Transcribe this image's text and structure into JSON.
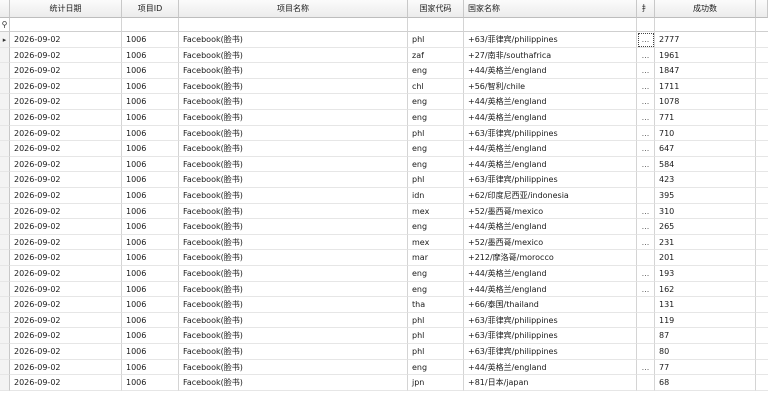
{
  "columns": {
    "date": "统计日期",
    "project_id": "项目ID",
    "project_name": "项目名称",
    "country_code": "国家代码",
    "country_name": "国家名称",
    "extra": "扌",
    "success_count": "成功数"
  },
  "icons": {
    "filter_row": "pin-icon",
    "current_row": "arrow-right-icon",
    "cursor": "mouse-pointer-icon"
  },
  "rows": [
    {
      "date": "2026-09-02",
      "project_id": "1006",
      "project_name": "Facebook(脸书)",
      "country_code": "phl",
      "country_name": "+63/菲律宾/philippines",
      "extra": "...",
      "success_count": "2777"
    },
    {
      "date": "2026-09-02",
      "project_id": "1006",
      "project_name": "Facebook(脸书)",
      "country_code": "zaf",
      "country_name": "+27/南非/southafrica",
      "extra": "...",
      "success_count": "1961"
    },
    {
      "date": "2026-09-02",
      "project_id": "1006",
      "project_name": "Facebook(脸书)",
      "country_code": "eng",
      "country_name": "+44/英格兰/england",
      "extra": "...",
      "success_count": "1847"
    },
    {
      "date": "2026-09-02",
      "project_id": "1006",
      "project_name": "Facebook(脸书)",
      "country_code": "chl",
      "country_name": "+56/智利/chile",
      "extra": "...",
      "success_count": "1711"
    },
    {
      "date": "2026-09-02",
      "project_id": "1006",
      "project_name": "Facebook(脸书)",
      "country_code": "eng",
      "country_name": "+44/英格兰/england",
      "extra": "...",
      "success_count": "1078"
    },
    {
      "date": "2026-09-02",
      "project_id": "1006",
      "project_name": "Facebook(脸书)",
      "country_code": "eng",
      "country_name": "+44/英格兰/england",
      "extra": "...",
      "success_count": "771"
    },
    {
      "date": "2026-09-02",
      "project_id": "1006",
      "project_name": "Facebook(脸书)",
      "country_code": "phl",
      "country_name": "+63/菲律宾/philippines",
      "extra": "...",
      "success_count": "710"
    },
    {
      "date": "2026-09-02",
      "project_id": "1006",
      "project_name": "Facebook(脸书)",
      "country_code": "eng",
      "country_name": "+44/英格兰/england",
      "extra": "...",
      "success_count": "647"
    },
    {
      "date": "2026-09-02",
      "project_id": "1006",
      "project_name": "Facebook(脸书)",
      "country_code": "eng",
      "country_name": "+44/英格兰/england",
      "extra": "...",
      "success_count": "584"
    },
    {
      "date": "2026-09-02",
      "project_id": "1006",
      "project_name": "Facebook(脸书)",
      "country_code": "phl",
      "country_name": "+63/菲律宾/philippines",
      "extra": "",
      "success_count": "423"
    },
    {
      "date": "2026-09-02",
      "project_id": "1006",
      "project_name": "Facebook(脸书)",
      "country_code": "idn",
      "country_name": "+62/印度尼西亚/indonesia",
      "extra": "",
      "success_count": "395"
    },
    {
      "date": "2026-09-02",
      "project_id": "1006",
      "project_name": "Facebook(脸书)",
      "country_code": "mex",
      "country_name": "+52/墨西哥/mexico",
      "extra": "...",
      "success_count": "310"
    },
    {
      "date": "2026-09-02",
      "project_id": "1006",
      "project_name": "Facebook(脸书)",
      "country_code": "eng",
      "country_name": "+44/英格兰/england",
      "extra": "...",
      "success_count": "265"
    },
    {
      "date": "2026-09-02",
      "project_id": "1006",
      "project_name": "Facebook(脸书)",
      "country_code": "mex",
      "country_name": "+52/墨西哥/mexico",
      "extra": "...",
      "success_count": "231"
    },
    {
      "date": "2026-09-02",
      "project_id": "1006",
      "project_name": "Facebook(脸书)",
      "country_code": "mar",
      "country_name": "+212/摩洛哥/morocco",
      "extra": "",
      "success_count": "201"
    },
    {
      "date": "2026-09-02",
      "project_id": "1006",
      "project_name": "Facebook(脸书)",
      "country_code": "eng",
      "country_name": "+44/英格兰/england",
      "extra": "...",
      "success_count": "193"
    },
    {
      "date": "2026-09-02",
      "project_id": "1006",
      "project_name": "Facebook(脸书)",
      "country_code": "eng",
      "country_name": "+44/英格兰/england",
      "extra": "...",
      "success_count": "162"
    },
    {
      "date": "2026-09-02",
      "project_id": "1006",
      "project_name": "Facebook(脸书)",
      "country_code": "tha",
      "country_name": "+66/泰国/thailand",
      "extra": "",
      "success_count": "131"
    },
    {
      "date": "2026-09-02",
      "project_id": "1006",
      "project_name": "Facebook(脸书)",
      "country_code": "phl",
      "country_name": "+63/菲律宾/philippines",
      "extra": "",
      "success_count": "119"
    },
    {
      "date": "2026-09-02",
      "project_id": "1006",
      "project_name": "Facebook(脸书)",
      "country_code": "phl",
      "country_name": "+63/菲律宾/philippines",
      "extra": "",
      "success_count": "87"
    },
    {
      "date": "2026-09-02",
      "project_id": "1006",
      "project_name": "Facebook(脸书)",
      "country_code": "phl",
      "country_name": "+63/菲律宾/philippines",
      "extra": "",
      "success_count": "80"
    },
    {
      "date": "2026-09-02",
      "project_id": "1006",
      "project_name": "Facebook(脸书)",
      "country_code": "eng",
      "country_name": "+44/英格兰/england",
      "extra": "...",
      "success_count": "77"
    },
    {
      "date": "2026-09-02",
      "project_id": "1006",
      "project_name": "Facebook(脸书)",
      "country_code": "jpn",
      "country_name": "+81/日本/japan",
      "extra": "",
      "success_count": "68"
    }
  ]
}
